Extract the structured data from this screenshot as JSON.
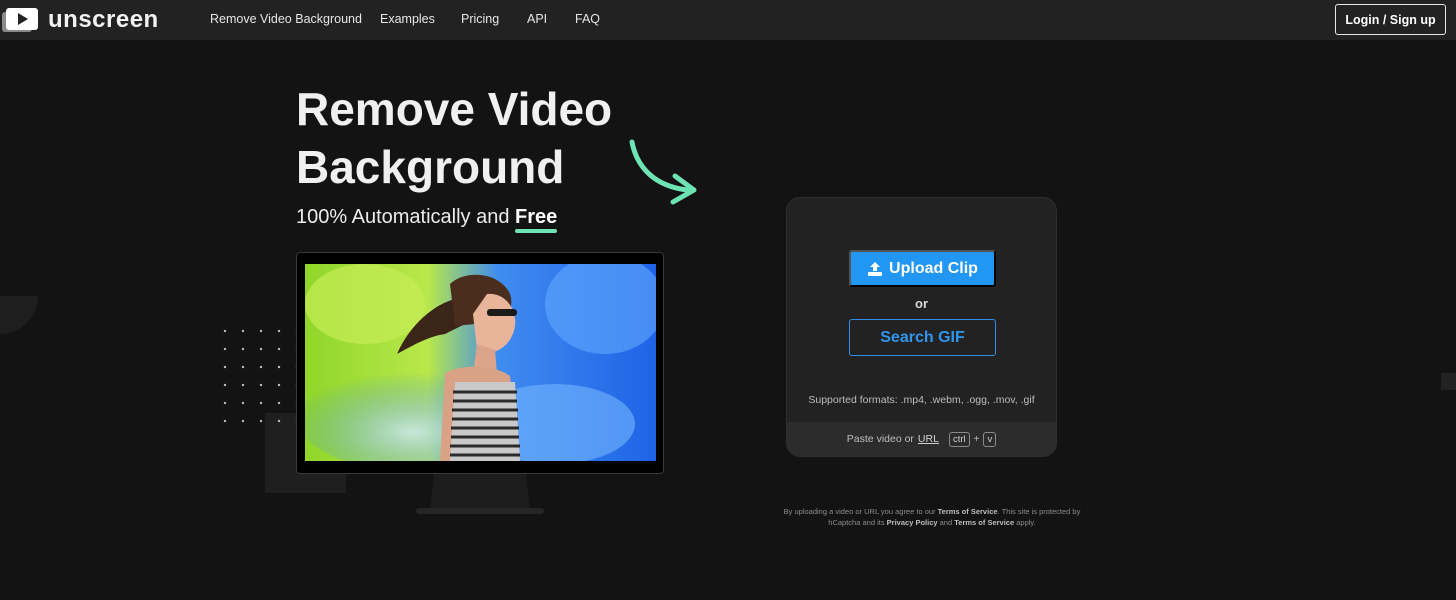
{
  "nav": {
    "brand": "unscreen",
    "links": [
      "Remove Video Background",
      "Examples",
      "Pricing",
      "API",
      "FAQ"
    ],
    "login_label": "Login / Sign up"
  },
  "hero": {
    "title_line1": "Remove Video",
    "title_line2": "Background",
    "subtitle_prefix": "100% Automatically and",
    "subtitle_highlight": "Free",
    "accent_color": "#6ee3b4"
  },
  "upload": {
    "upload_label": "Upload Clip",
    "or_label": "or",
    "gif_label": "Search GIF",
    "formats": "Supported formats: .mp4, .webm, .ogg, .mov, .gif",
    "paste_prefix": "Paste video or",
    "paste_url": "URL",
    "key1": "ctrl",
    "plus": "+",
    "key2": "v",
    "primary_color": "#2196f3"
  },
  "legal": {
    "t1": "By uploading a video or URL you agree to our",
    "tos": "Terms of Service",
    "t2": ". This site is protected by hCaptcha and its",
    "privacy": "Privacy Policy",
    "t3": "and",
    "tos2": "Terms of Service",
    "t4": "apply."
  }
}
